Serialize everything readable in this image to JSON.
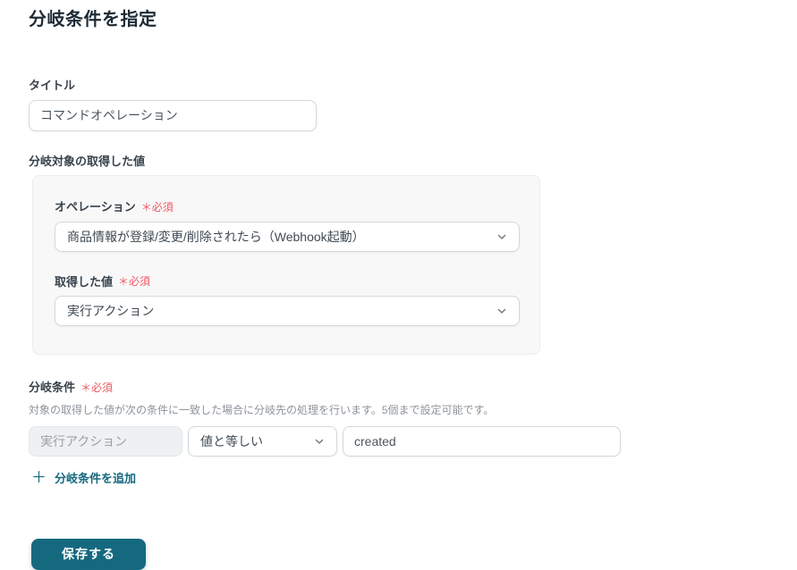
{
  "page": {
    "title": "分岐条件を指定"
  },
  "colors": {
    "accent_teal": "#15697f",
    "required_red": "#ef5761",
    "card_background": "#f8f8f9",
    "text_dark": "#1e2b36",
    "text_muted": "#8e949b"
  },
  "title_field": {
    "label": "タイトル",
    "value": "コマンドオペレーション"
  },
  "target_section": {
    "label": "分岐対象の取得した値",
    "operation": {
      "label": "オペレーション",
      "required_badge": "＊必須",
      "selected": "商品情報が登録/変更/削除されたら（Webhook起動）"
    },
    "acquired_value": {
      "label": "取得した値",
      "required_badge": "＊必須",
      "selected": "実行アクション"
    }
  },
  "condition_section": {
    "label": "分岐条件",
    "required_badge": "＊必須",
    "description": "対象の取得した値が次の条件に一致した場合に分岐先の処理を行います。5個まで設定可能です。",
    "row": {
      "target_value": "実行アクション",
      "operator_selected": "値と等しい",
      "value": "created"
    },
    "add_icon": "＋",
    "add_label": "分岐条件を追加"
  },
  "save_button": {
    "label": "保存する"
  }
}
